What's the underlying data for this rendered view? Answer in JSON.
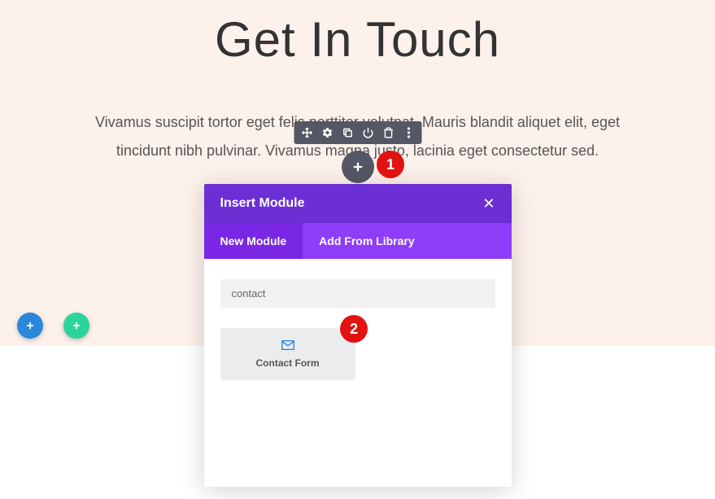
{
  "page": {
    "title": "Get In Touch",
    "subtitle": "Vivamus suscipit tortor eget felis porttitor volutpat. Mauris blandit aliquet elit, eget tincidunt nibh pulvinar. Vivamus magna justo, lacinia eget consectetur sed."
  },
  "badges": {
    "one": "1",
    "two": "2"
  },
  "modal": {
    "title": "Insert Module",
    "tabs": {
      "new_module": "New Module",
      "add_from_library": "Add From Library"
    },
    "search_value": "contact",
    "module_label": "Contact Form"
  }
}
